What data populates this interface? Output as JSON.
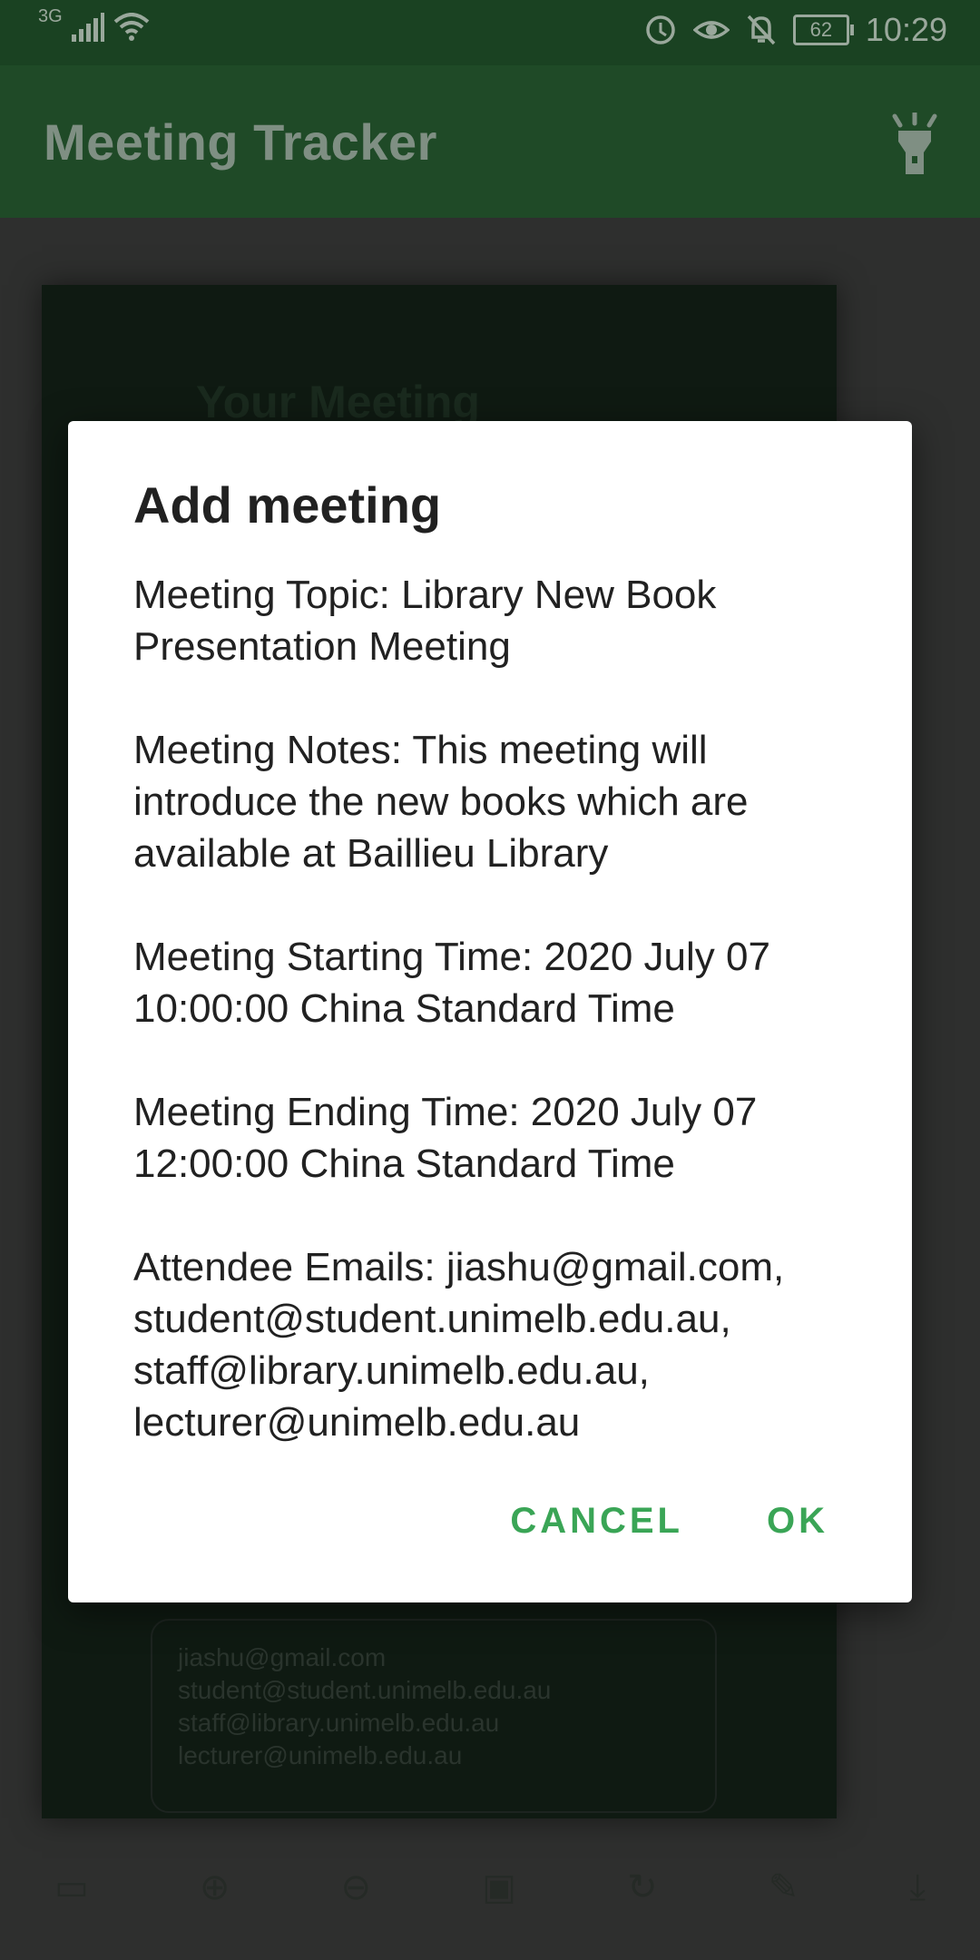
{
  "status_bar": {
    "network": "3G",
    "battery": "62",
    "time": "10:29",
    "icons": [
      "signal-icon",
      "wifi-icon",
      "data-saver-icon",
      "eye-icon",
      "bell-off-icon",
      "battery-icon"
    ]
  },
  "app_bar": {
    "title": "Meeting Tracker",
    "action_icon": "flashlight-icon"
  },
  "background": {
    "photo_title": "Your Meeting",
    "emails": [
      "jiashu@gmail.com",
      "student@student.unimelb.edu.au",
      "staff@library.unimelb.edu.au",
      "lecturer@unimelb.edu.au"
    ]
  },
  "dialog": {
    "title": "Add meeting",
    "topic": "Meeting Topic: Library New Book Presentation Meeting",
    "notes": "Meeting Notes: This meeting will introduce the new books which are available at Baillieu Library",
    "start": "Meeting Starting Time: 2020 July 07 10:00:00 China Standard Time",
    "end": "Meeting Ending Time: 2020 July 07 12:00:00 China Standard Time",
    "emails": "Attendee Emails: jiashu@gmail.com, student@student.unimelb.edu.au, staff@library.unimelb.edu.au, lecturer@unimelb.edu.au",
    "cancel_label": "CANCEL",
    "ok_label": "OK"
  },
  "colors": {
    "status_bar": "#1a4222",
    "app_bar": "#1f4a27",
    "accent": "#3aa556"
  }
}
